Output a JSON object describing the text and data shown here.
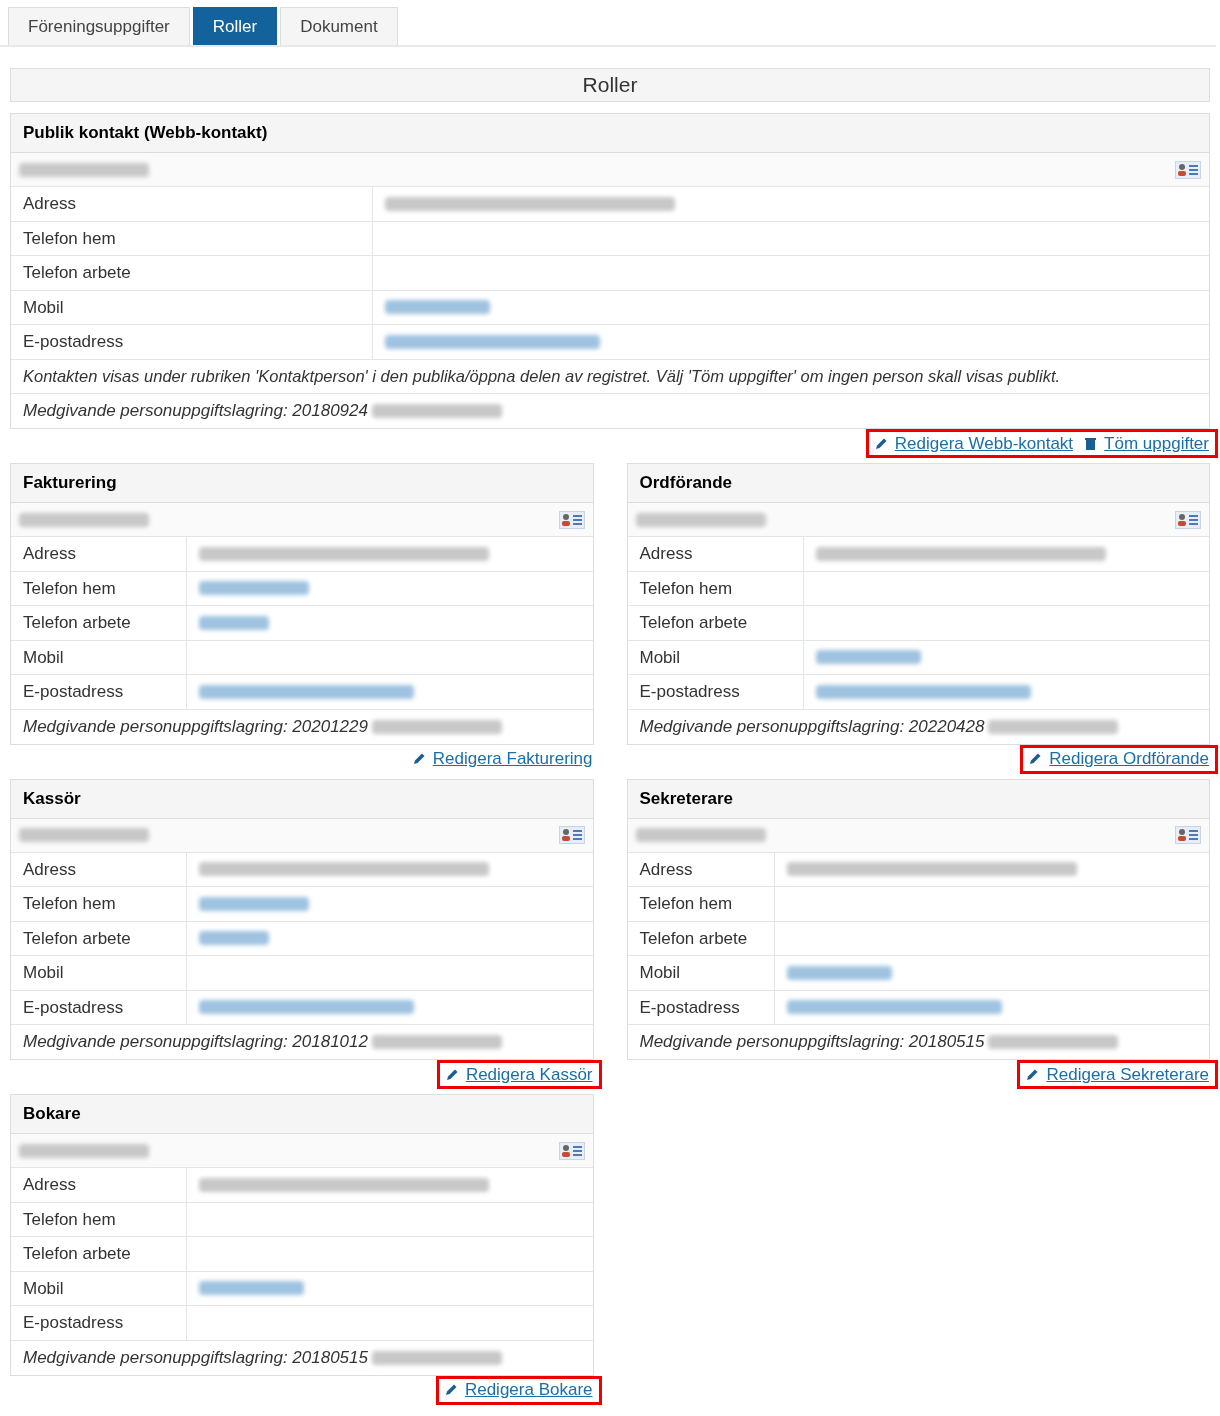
{
  "tabs": [
    {
      "label": "Föreningsuppgifter",
      "selected": false
    },
    {
      "label": "Roller",
      "selected": true
    },
    {
      "label": "Dokument",
      "selected": false
    }
  ],
  "section_title": "Roller",
  "cards": [
    {
      "title": "Publik kontakt (Webb-kontakt)",
      "wide": true,
      "fields": [
        {
          "label": "Adress",
          "redacted": true,
          "linked": false
        },
        {
          "label": "Telefon hem",
          "redacted": false
        },
        {
          "label": "Telefon arbete",
          "redacted": false
        },
        {
          "label": "Mobil",
          "redacted": true,
          "linked": true
        },
        {
          "label": "E-postadress",
          "redacted": true,
          "linked": true
        }
      ],
      "note": "Kontakten visas under rubriken 'Kontaktperson' i den publika/öppna delen av registret. Välj 'Töm uppgifter' om ingen person skall visas publikt.",
      "consent": "Medgivande personuppgiftslagring: 20180924",
      "actions": [
        {
          "kind": "edit",
          "label": "Redigera Webb-kontakt"
        },
        {
          "kind": "clear",
          "label": "Töm uppgifter"
        }
      ],
      "highlighted": true
    },
    {
      "title": "Fakturering",
      "wide": false,
      "fields": [
        {
          "label": "Adress",
          "redacted": true,
          "linked": false
        },
        {
          "label": "Telefon hem",
          "redacted": true,
          "linked": true
        },
        {
          "label": "Telefon arbete",
          "redacted": true,
          "linked": true
        },
        {
          "label": "Mobil",
          "redacted": false
        },
        {
          "label": "E-postadress",
          "redacted": true,
          "linked": true
        }
      ],
      "consent": "Medgivande personuppgiftslagring: 20201229",
      "actions": [
        {
          "kind": "edit",
          "label": "Redigera Fakturering"
        }
      ],
      "highlighted": false
    },
    {
      "title": "Ordförande",
      "wide": false,
      "fields": [
        {
          "label": "Adress",
          "redacted": true,
          "linked": false
        },
        {
          "label": "Telefon hem",
          "redacted": false
        },
        {
          "label": "Telefon arbete",
          "redacted": false
        },
        {
          "label": "Mobil",
          "redacted": true,
          "linked": true
        },
        {
          "label": "E-postadress",
          "redacted": true,
          "linked": true
        }
      ],
      "consent": "Medgivande personuppgiftslagring: 20220428",
      "actions": [
        {
          "kind": "edit",
          "label": "Redigera Ordförande"
        }
      ],
      "highlighted": true
    },
    {
      "title": "Kassör",
      "wide": false,
      "fields": [
        {
          "label": "Adress",
          "redacted": true,
          "linked": false
        },
        {
          "label": "Telefon hem",
          "redacted": true,
          "linked": true
        },
        {
          "label": "Telefon arbete",
          "redacted": true,
          "linked": true
        },
        {
          "label": "Mobil",
          "redacted": false
        },
        {
          "label": "E-postadress",
          "redacted": true,
          "linked": true
        }
      ],
      "consent": "Medgivande personuppgiftslagring: 20181012",
      "actions": [
        {
          "kind": "edit",
          "label": "Redigera Kassör"
        }
      ],
      "highlighted": true
    },
    {
      "title": "Sekreterare",
      "wide": false,
      "fields": [
        {
          "label": "Adress",
          "redacted": true,
          "linked": false
        },
        {
          "label": "Telefon hem",
          "redacted": false
        },
        {
          "label": "Telefon arbete",
          "redacted": false
        },
        {
          "label": "Mobil",
          "redacted": true,
          "linked": true
        },
        {
          "label": "E-postadress",
          "redacted": true,
          "linked": true
        }
      ],
      "consent": "Medgivande personuppgiftslagring: 20180515",
      "actions": [
        {
          "kind": "edit",
          "label": "Redigera Sekreterare"
        }
      ],
      "highlighted": true
    },
    {
      "title": "Bokare",
      "wide": false,
      "fields": [
        {
          "label": "Adress",
          "redacted": true,
          "linked": false
        },
        {
          "label": "Telefon hem",
          "redacted": false
        },
        {
          "label": "Telefon arbete",
          "redacted": false
        },
        {
          "label": "Mobil",
          "redacted": true,
          "linked": true
        },
        {
          "label": "E-postadress",
          "redacted": false
        }
      ],
      "consent": "Medgivande personuppgiftslagring: 20180515",
      "actions": [
        {
          "kind": "edit",
          "label": "Redigera Bokare"
        }
      ],
      "highlighted": true
    }
  ]
}
